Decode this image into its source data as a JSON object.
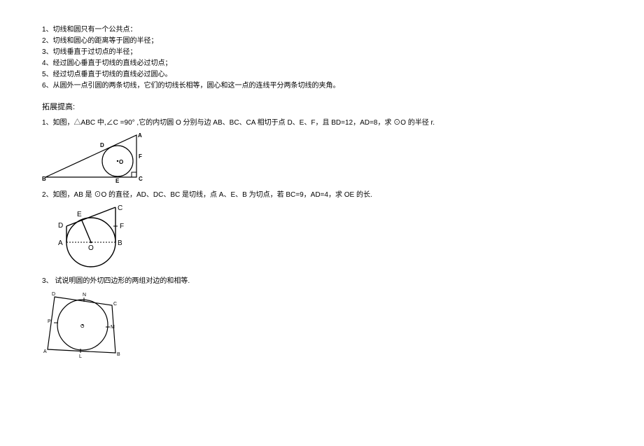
{
  "properties": {
    "items": [
      "1、切线和圆只有一个公共点：",
      "2、切线和圆心的距离等于圆的半径；",
      "3、切线垂直于过切点的半径；",
      "4、经过圆心垂直于切线的直线必过切点；",
      "5、经过切点垂直于切线的直线必过圆心。",
      "6、从圆外一点引圆的两条切线，它们的切线长相等，圆心和这一点的连线平分两条切线的夹角。"
    ]
  },
  "section": {
    "title": "拓展提高:"
  },
  "problem1": {
    "text": "1、如图，△ABC 中,∠C =90° ,它的内切圆 O 分别与边 AB、BC、CA 相切于点 D、E、F，且 BD=12，AD=8，求 ⊙O 的半径 r.",
    "labels": {
      "A": "A",
      "B": "B",
      "C": "C",
      "D": "D",
      "E": "E",
      "F": "F",
      "O": "O"
    }
  },
  "problem2": {
    "text": "2、如图，AB 是 ⊙O 的直径，AD、DC、BC 是切线，点 A、E、B 为切点，若 BC=9，AD=4，求 OE 的长.",
    "labels": {
      "A": "A",
      "B": "B",
      "C": "C",
      "D": "D",
      "E": "E",
      "F": "F",
      "O": "O"
    }
  },
  "problem3": {
    "text": "3、 试说明圆的外切四边形的两组对边的和相等.",
    "labels": {
      "A": "A",
      "B": "B",
      "C": "C",
      "D": "D",
      "L": "L",
      "M": "M",
      "N": "N",
      "P": "P",
      "O": "O"
    }
  }
}
